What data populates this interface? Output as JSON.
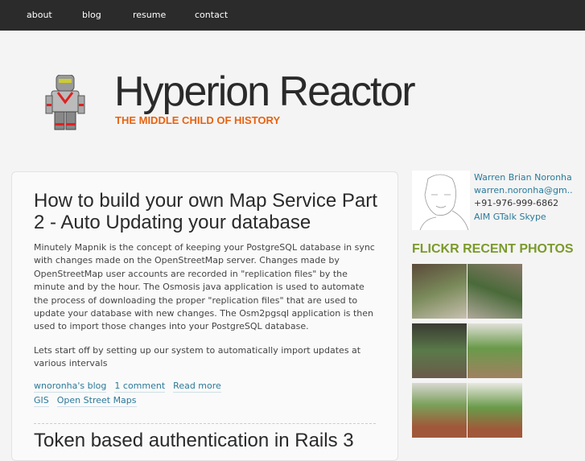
{
  "nav": {
    "items": [
      "about",
      "blog",
      "resume",
      "contact"
    ]
  },
  "site": {
    "title": "Hyperion Reactor",
    "slogan": "THE MIDDLE CHILD OF HISTORY"
  },
  "post": {
    "title": "How to build your own Map Service Part 2 - Auto Updating your database",
    "paragraphs": [
      "Minutely Mapnik is the concept of keeping your PostgreSQL database in sync with changes made on the OpenStreetMap server. Changes made by OpenStreetMap user accounts are recorded in \"replication files\" by the minute and by the hour. The Osmosis java application is used to automate the process of downloading the proper \"replication files\" that are used to update your database with new changes. The Osm2pgsql application is then used to import those changes into your PostgreSQL database.",
      "Lets start off by setting up our system to automatically import updates at various intervals"
    ],
    "links": [
      "wnoronha's blog",
      "1 comment",
      "Read more"
    ],
    "tags": [
      "GIS",
      "Open Street Maps"
    ]
  },
  "next_post": {
    "title": "Token based authentication in Rails 3"
  },
  "profile": {
    "name": "Warren Brian Noronha",
    "email": "warren.noronha@gm..",
    "phone": "+91-976-999-6862",
    "im": [
      "AIM",
      "GTalk",
      "Skype"
    ]
  },
  "flickr": {
    "heading": "FLICKR RECENT PHOTOS"
  },
  "colors": {
    "nav_bg": "#2b2b2b",
    "link": "#2a7a9a",
    "slogan": "#e8620f",
    "flickr_heading": "#7a9a2a"
  }
}
